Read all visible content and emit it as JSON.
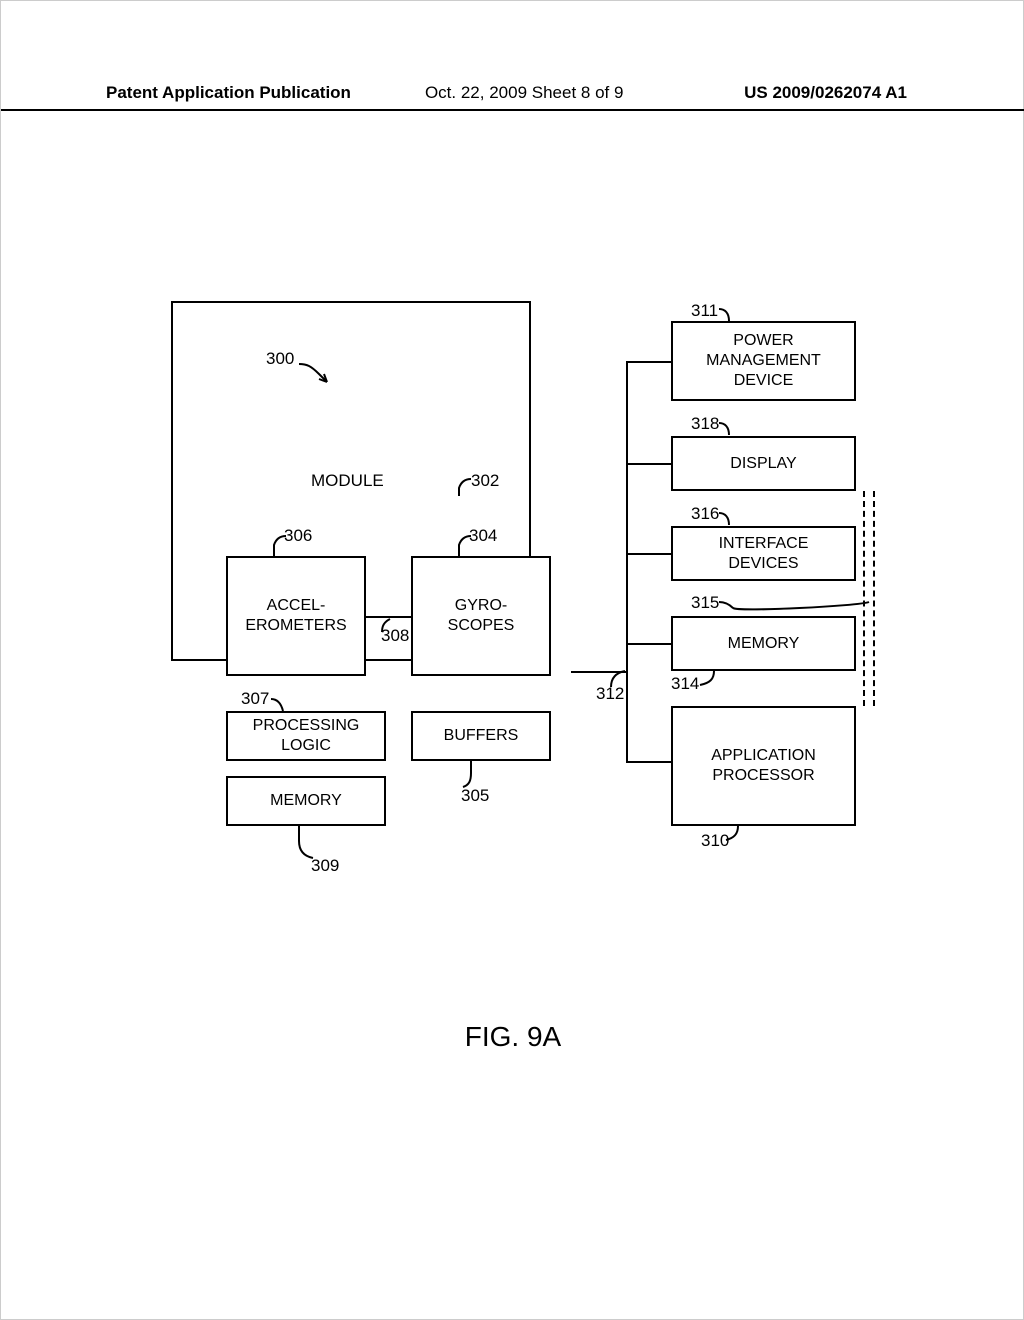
{
  "header": {
    "left": "Patent Application Publication",
    "mid": "Oct. 22, 2009  Sheet 8 of 9",
    "right": "US 2009/0262074 A1"
  },
  "figure": {
    "caption": "FIG. 9A"
  },
  "refs": {
    "system": "300",
    "module": "302",
    "gyro": "304",
    "buffers": "305",
    "accel": "306",
    "proc": "307",
    "bus_inner": "308",
    "memory_module": "309",
    "app_proc": "310",
    "pmd": "311",
    "bus_outer": "312",
    "memory_right": "314",
    "right_dashed_upper": "315",
    "iface": "316",
    "display": "318"
  },
  "labels": {
    "module": "MODULE",
    "accel": "ACCEL-\nEROMETERS",
    "gyro": "GYRO-\nSCOPES",
    "proc": "PROCESSING\nLOGIC",
    "mem_m": "MEMORY",
    "buf": "BUFFERS",
    "pmd": "POWER\nMANAGEMENT\nDEVICE",
    "disp": "DISPLAY",
    "iface": "INTERFACE\nDEVICES",
    "mem_r": "MEMORY",
    "app": "APPLICATION\nPROCESSOR"
  }
}
